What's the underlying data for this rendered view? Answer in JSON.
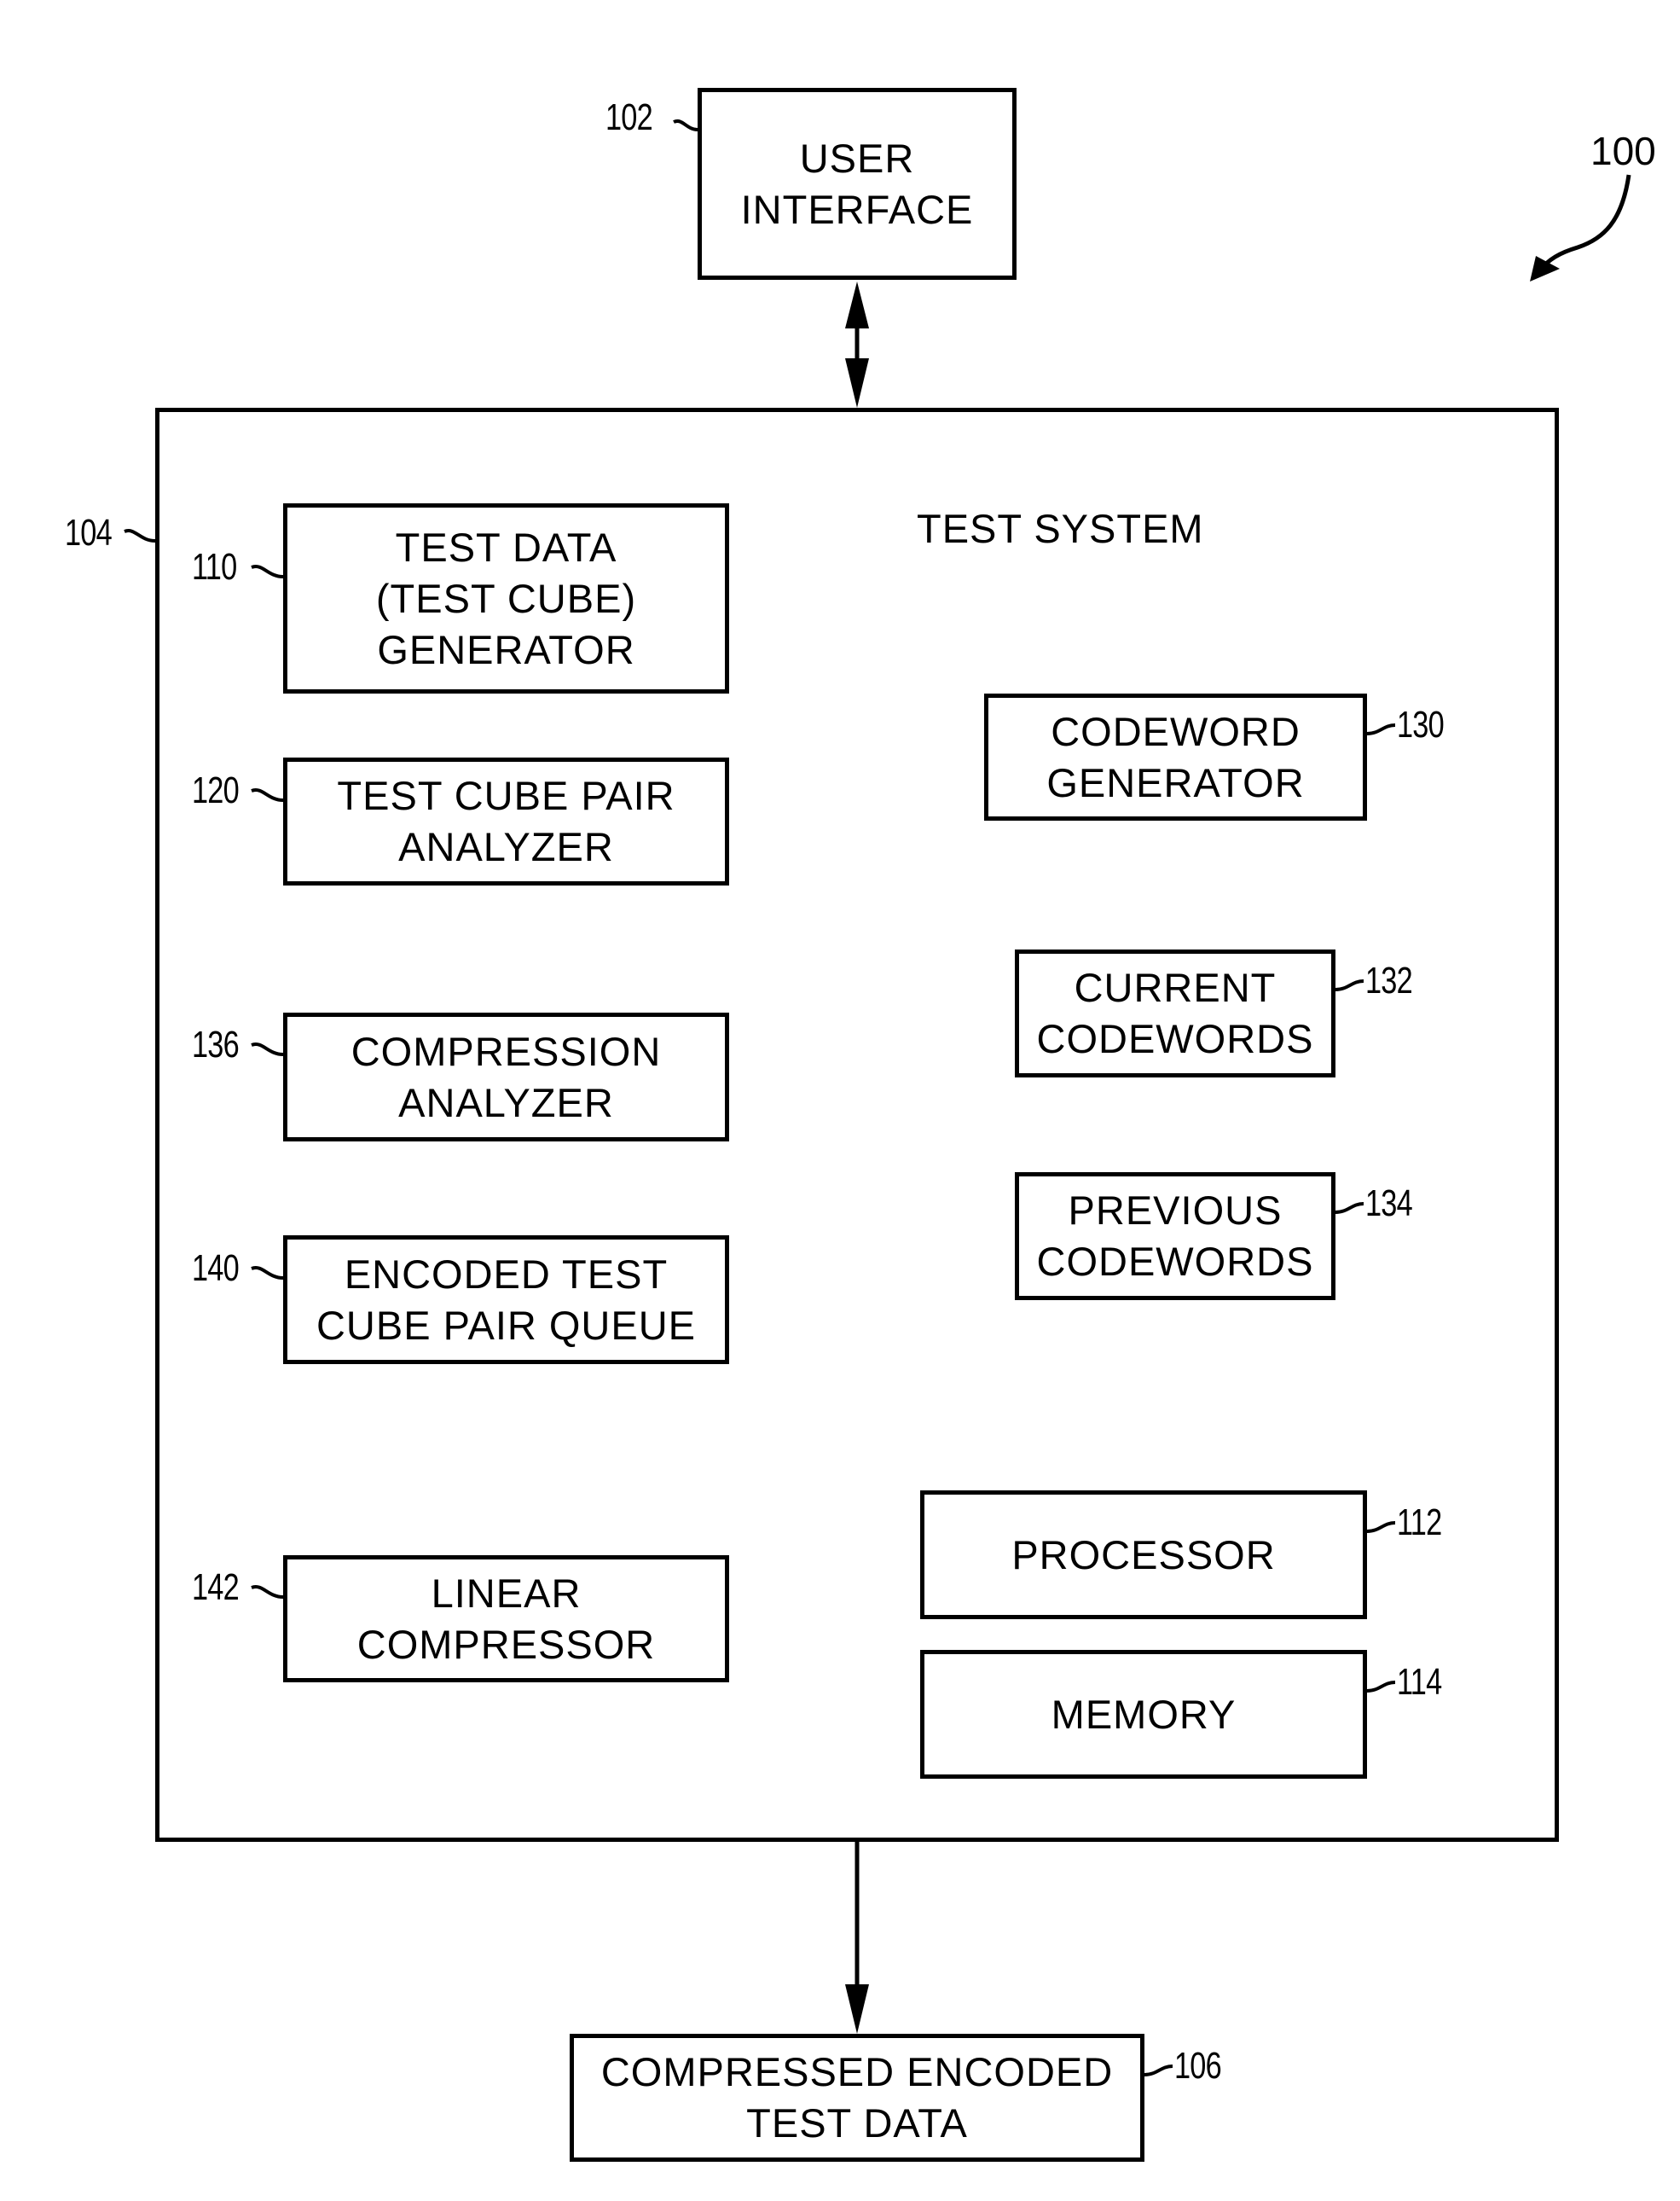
{
  "figure": {
    "ref": "100"
  },
  "user_interface": {
    "ref": "102",
    "lines": [
      "USER",
      "INTERFACE"
    ]
  },
  "test_system": {
    "ref": "104",
    "title": "TEST SYSTEM",
    "components": {
      "test_data_generator": {
        "ref": "110",
        "lines": [
          "TEST DATA",
          "(TEST CUBE)",
          "GENERATOR"
        ]
      },
      "test_cube_pair_analyzer": {
        "ref": "120",
        "lines": [
          "TEST CUBE PAIR",
          "ANALYZER"
        ]
      },
      "compression_analyzer": {
        "ref": "136",
        "lines": [
          "COMPRESSION",
          "ANALYZER"
        ]
      },
      "encoded_queue": {
        "ref": "140",
        "lines": [
          "ENCODED TEST",
          "CUBE PAIR QUEUE"
        ]
      },
      "linear_compressor": {
        "ref": "142",
        "lines": [
          "LINEAR",
          "COMPRESSOR"
        ]
      },
      "codeword_generator": {
        "ref": "130",
        "lines": [
          "CODEWORD",
          "GENERATOR"
        ]
      },
      "current_codewords": {
        "ref": "132",
        "lines": [
          "CURRENT",
          "CODEWORDS"
        ]
      },
      "previous_codewords": {
        "ref": "134",
        "lines": [
          "PREVIOUS",
          "CODEWORDS"
        ]
      },
      "processor": {
        "ref": "112",
        "lines": [
          "PROCESSOR"
        ]
      },
      "memory": {
        "ref": "114",
        "lines": [
          "MEMORY"
        ]
      }
    }
  },
  "output": {
    "ref": "106",
    "lines": [
      "COMPRESSED ENCODED",
      "TEST DATA"
    ]
  }
}
